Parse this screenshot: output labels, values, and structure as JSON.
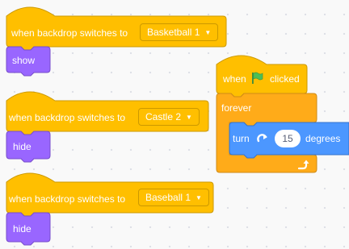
{
  "colors": {
    "events": "#FFBF00",
    "events_border": "#CC9900",
    "looks": "#9966FF",
    "control": "#FFAB19",
    "motion": "#4C97FF",
    "flag": "#4CBF56"
  },
  "scripts": [
    {
      "hat_label": "when backdrop switches to",
      "backdrop": "Basketball 1",
      "body_label": "show"
    },
    {
      "hat_label": "when backdrop switches to",
      "backdrop": "Castle 2",
      "body_label": "hide"
    },
    {
      "hat_label": "when backdrop switches to",
      "backdrop": "Baseball 1",
      "body_label": "hide"
    }
  ],
  "flag_script": {
    "when_label": "when",
    "flag_icon": "green-flag-icon",
    "clicked_label": "clicked",
    "forever_label": "forever",
    "turn_label": "turn",
    "turn_icon": "rotate-clockwise-icon",
    "degrees_value": "15",
    "degrees_label": "degrees",
    "loop_icon": "loop-arrow-icon"
  }
}
